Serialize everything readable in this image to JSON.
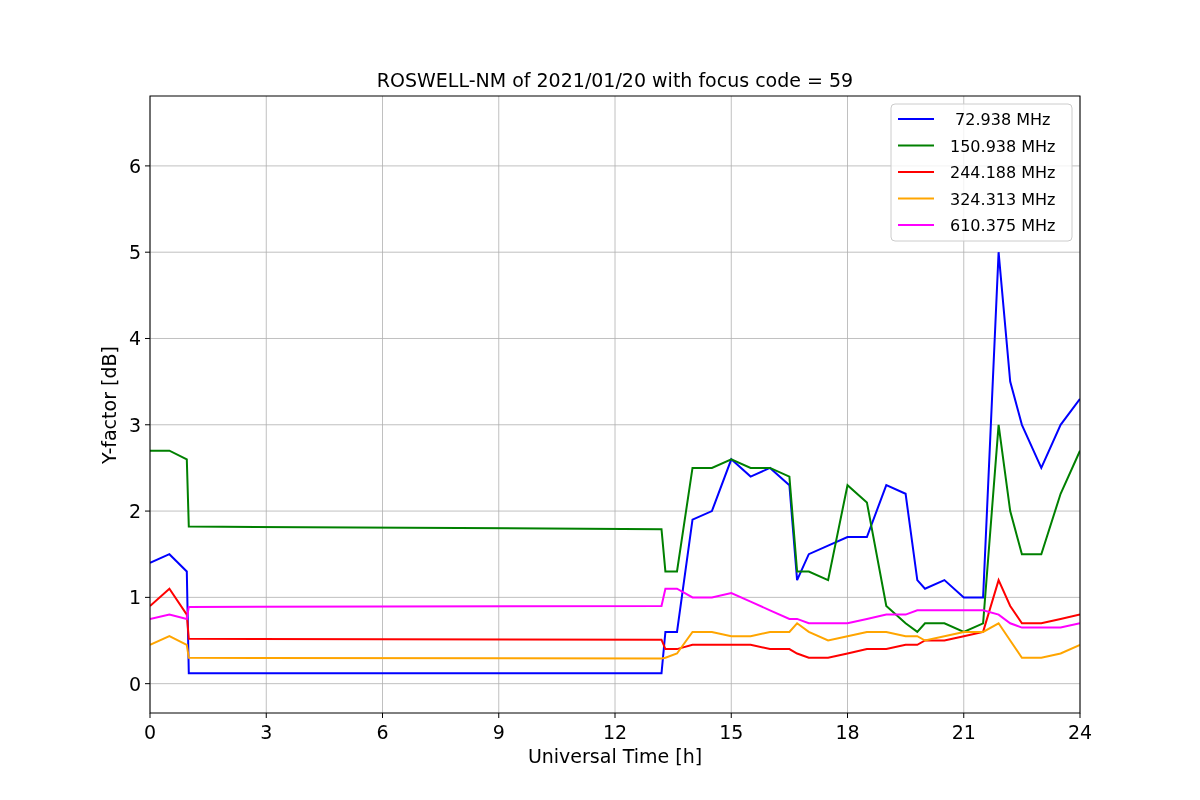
{
  "figure": {
    "chart_data": {
      "type": "line",
      "title": "ROSWELL-NM of 2021/01/20 with focus code = 59",
      "xlabel": "Universal Time [h]",
      "ylabel": "Y-factor [dB]",
      "x": [
        0,
        0.5,
        0.95,
        1.0,
        13.2,
        13.3,
        13.6,
        14,
        14.5,
        15,
        15.5,
        16,
        16.5,
        16.7,
        17,
        17.5,
        18,
        18.5,
        19,
        19.5,
        19.8,
        20,
        20.5,
        21,
        21.5,
        21.9,
        22.2,
        22.5,
        23,
        23.5,
        24
      ],
      "series": [
        {
          "name": " 72.938 MHz",
          "color": "#0000ff",
          "values": [
            1.4,
            1.5,
            1.3,
            0.12,
            0.12,
            0.6,
            0.6,
            1.9,
            2.0,
            2.6,
            2.4,
            2.5,
            2.3,
            1.2,
            1.5,
            1.6,
            1.7,
            1.7,
            2.3,
            2.2,
            1.2,
            1.1,
            1.2,
            1.0,
            1.0,
            5.0,
            3.5,
            3.0,
            2.5,
            3.0,
            3.3
          ]
        },
        {
          "name": "150.938 MHz",
          "color": "#008000",
          "values": [
            2.7,
            2.7,
            2.6,
            1.82,
            1.79,
            1.3,
            1.3,
            2.5,
            2.5,
            2.6,
            2.5,
            2.5,
            2.4,
            1.3,
            1.3,
            1.2,
            2.3,
            2.1,
            0.9,
            0.7,
            0.6,
            0.7,
            0.7,
            0.6,
            0.7,
            3.0,
            2.0,
            1.5,
            1.5,
            2.2,
            2.7
          ]
        },
        {
          "name": "244.188 MHz",
          "color": "#ff0000",
          "values": [
            0.9,
            1.1,
            0.8,
            0.52,
            0.51,
            0.4,
            0.4,
            0.45,
            0.45,
            0.45,
            0.45,
            0.4,
            0.4,
            0.35,
            0.3,
            0.3,
            0.35,
            0.4,
            0.4,
            0.45,
            0.45,
            0.5,
            0.5,
            0.55,
            0.6,
            1.2,
            0.9,
            0.7,
            0.7,
            0.75,
            0.8
          ]
        },
        {
          "name": "324.313 MHz",
          "color": "#ffa500",
          "values": [
            0.45,
            0.55,
            0.45,
            0.3,
            0.29,
            0.3,
            0.35,
            0.6,
            0.6,
            0.55,
            0.55,
            0.6,
            0.6,
            0.7,
            0.6,
            0.5,
            0.55,
            0.6,
            0.6,
            0.55,
            0.55,
            0.5,
            0.55,
            0.6,
            0.6,
            0.7,
            0.5,
            0.3,
            0.3,
            0.35,
            0.45
          ]
        },
        {
          "name": "610.375 MHz",
          "color": "#ff00ff",
          "values": [
            0.75,
            0.8,
            0.75,
            0.89,
            0.9,
            1.1,
            1.1,
            1.0,
            1.0,
            1.05,
            0.95,
            0.85,
            0.75,
            0.75,
            0.7,
            0.7,
            0.7,
            0.75,
            0.8,
            0.8,
            0.85,
            0.85,
            0.85,
            0.85,
            0.85,
            0.8,
            0.7,
            0.65,
            0.65,
            0.65,
            0.7
          ]
        }
      ],
      "grid": true,
      "legend": true,
      "xlim": [
        0,
        24
      ],
      "ylim": [
        -0.34,
        6.81
      ],
      "xticks": [
        0,
        3,
        6,
        9,
        12,
        15,
        18,
        21,
        24
      ],
      "yticks": [
        0,
        1,
        2,
        3,
        4,
        5,
        6
      ]
    }
  }
}
